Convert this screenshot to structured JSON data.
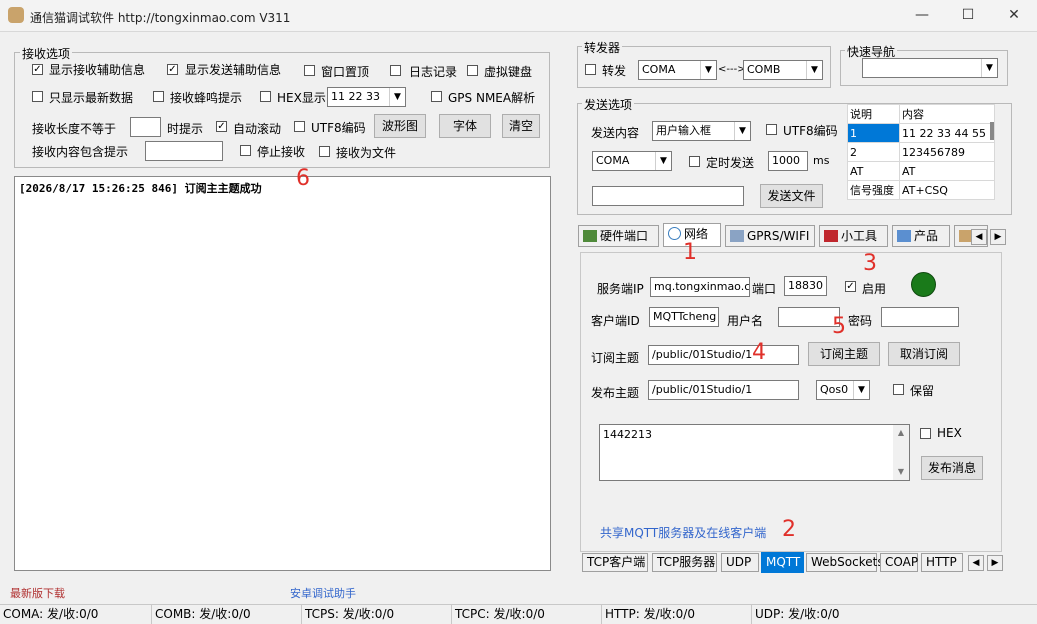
{
  "window": {
    "title": "通信猫调试软件  http://tongxinmao.com  V311",
    "min": "—",
    "max": "☐",
    "close": "✕"
  },
  "recv_options": {
    "legend": "接收选项",
    "show_recv_aux": "显示接收辅助信息",
    "show_send_aux": "显示发送辅助信息",
    "window_top": "窗口置顶",
    "log": "日志记录",
    "virtual_kb": "虚拟键盘",
    "only_latest": "只显示最新数据",
    "recv_beep": "接收蜂鸣提示",
    "hex_show": "HEX显示",
    "hex_value": "11 22 33",
    "gps": "GPS NMEA解析",
    "len_not_eq": "接收长度不等于",
    "len_value": "",
    "notify": "时提示",
    "auto_scroll": "自动滚动",
    "utf8": "UTF8编码",
    "waveform": "波形图",
    "font": "字体",
    "clear": "清空",
    "contains": "接收内容包含提示",
    "contains_value": "",
    "stop_recv": "停止接收",
    "recv_to_file": "接收为文件"
  },
  "log": {
    "timestamp": "[2026/8/17 15:26:25 846]",
    "message": "订阅主主题成功"
  },
  "forwarder": {
    "legend": "转发器",
    "forward": "转发",
    "from": "COMA",
    "arrow": "<--->",
    "to": "COMB"
  },
  "quicknav": {
    "legend": "快速导航",
    "value": ""
  },
  "send_options": {
    "legend": "发送选项",
    "content_label": "发送内容",
    "content_mode": "用户输入框",
    "utf8": "UTF8编码",
    "port": "COMA",
    "timed_send": "定时发送",
    "interval": "1000",
    "ms": "ms",
    "file_value": "",
    "send_file": "发送文件"
  },
  "cmd_table": {
    "headers": [
      "说明",
      "内容"
    ],
    "rows": [
      [
        "1",
        "11 22 33 44 55"
      ],
      [
        "2",
        "123456789"
      ],
      [
        "AT",
        "AT"
      ],
      [
        "信号强度",
        "AT+CSQ"
      ]
    ]
  },
  "top_tabs": [
    "硬件端口",
    "网络",
    "GPRS/WIFI",
    "小工具",
    "产品"
  ],
  "mqtt": {
    "server_ip_label": "服务端IP",
    "server_ip": "mq.tongxinmao.com",
    "port_label": "端口",
    "port": "18830",
    "enable": "启用",
    "client_id_label": "客户端ID",
    "client_id": "MQTTcheng",
    "user_label": "用户名",
    "user": "",
    "pass_label": "密码",
    "pass": "",
    "sub_label": "订阅主题",
    "sub_topic": "/public/01Studio/1",
    "sub_btn": "订阅主题",
    "unsub_btn": "取消订阅",
    "pub_label": "发布主题",
    "pub_topic": "/public/01Studio/1",
    "qos": "Qos0",
    "retain": "保留",
    "message": "1442213",
    "hex": "HEX",
    "publish_btn": "发布消息",
    "share_link": "共享MQTT服务器及在线客户端"
  },
  "bottom_tabs": [
    "TCP客户端",
    "TCP服务器",
    "UDP",
    "MQTT",
    "WebSockets",
    "COAP",
    "HTTP"
  ],
  "annotations": {
    "a1": "1",
    "a2": "2",
    "a3": "3",
    "a4": "4",
    "a5": "5",
    "a6": "6"
  },
  "footer_links": {
    "download": "最新版下载",
    "android": "安卓调试助手"
  },
  "status": [
    "COMA: 发/收:0/0",
    "COMB: 发/收:0/0",
    "TCPS: 发/收:0/0",
    "TCPC: 发/收:0/0",
    "HTTP: 发/收:0/0",
    "UDP: 发/收:0/0"
  ],
  "colors": {
    "accent": "#0078d7",
    "led": "#1a7a1a",
    "annotation": "#e0302a",
    "link": "#3366cc"
  }
}
